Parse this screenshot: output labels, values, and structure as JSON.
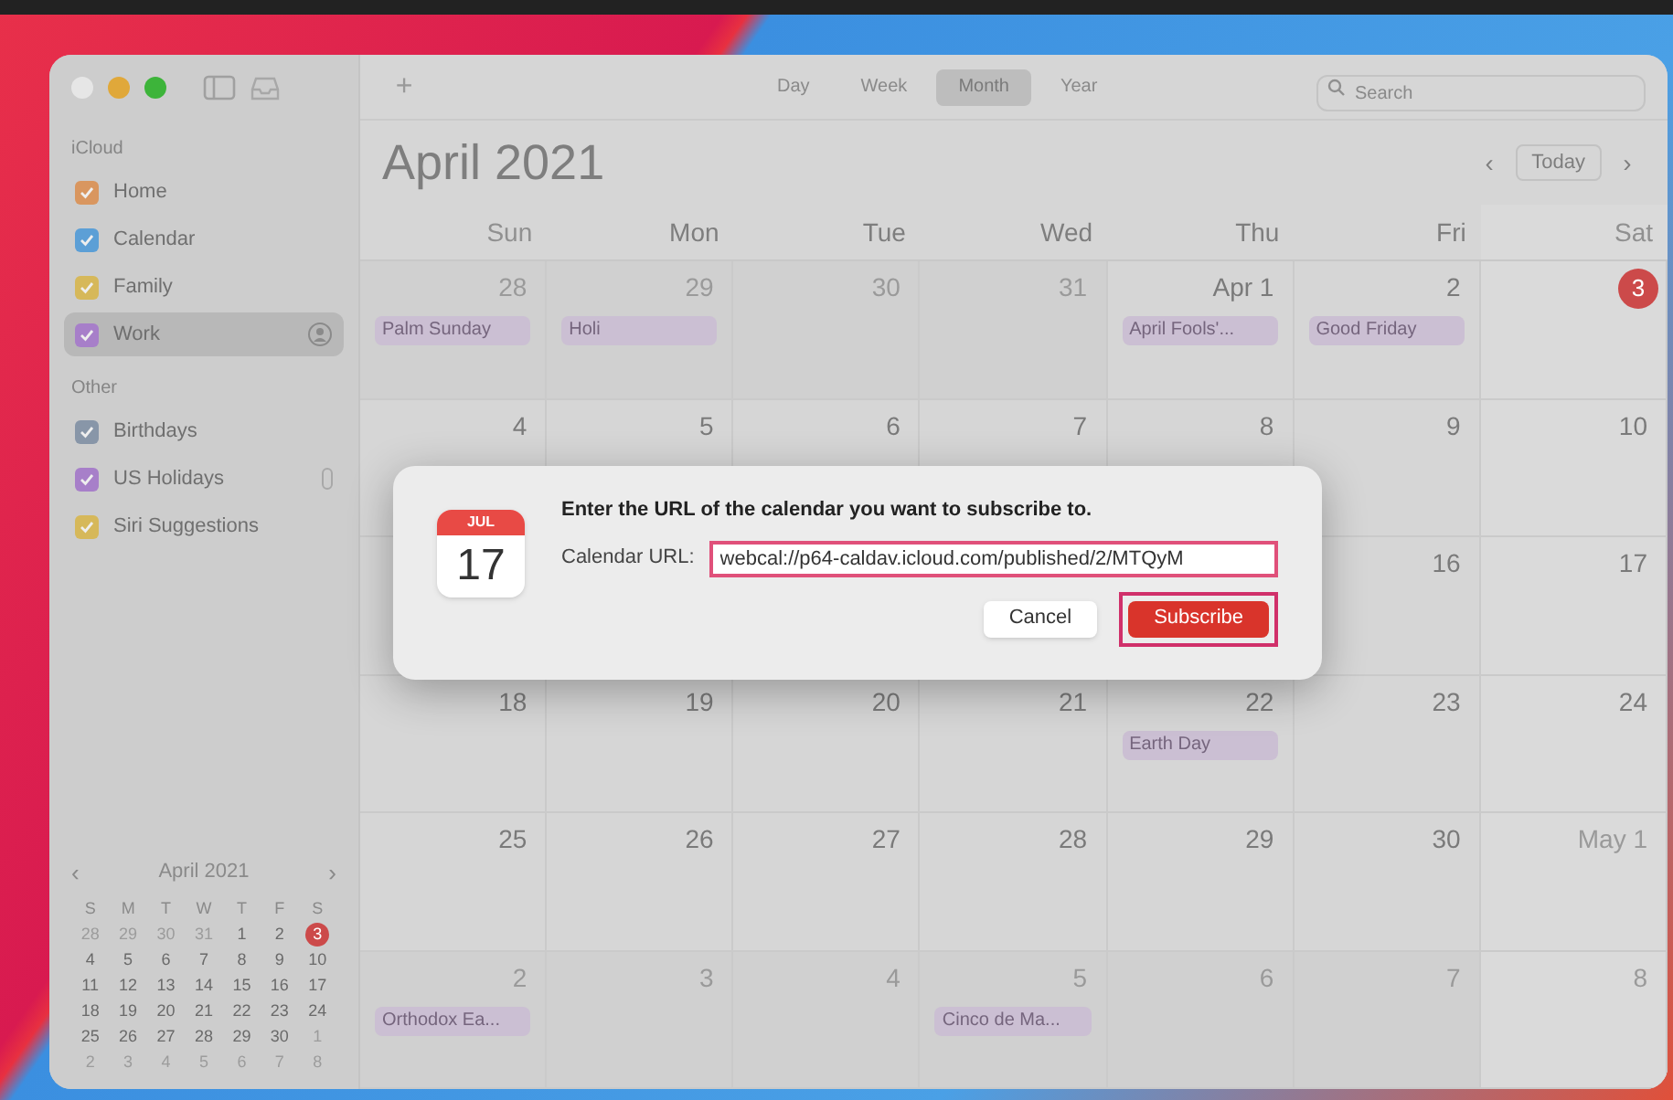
{
  "toolbar": {
    "add": "+",
    "views": [
      {
        "label": "Day",
        "selected": false
      },
      {
        "label": "Week",
        "selected": false
      },
      {
        "label": "Month",
        "selected": true
      },
      {
        "label": "Year",
        "selected": false
      }
    ],
    "search": {
      "placeholder": "Search"
    }
  },
  "sidebar": {
    "groups": [
      {
        "title": "iCloud",
        "items": [
          {
            "label": "Home",
            "color": "#d9965f",
            "selected": false,
            "shared": false,
            "subscribed": false
          },
          {
            "label": "Calendar",
            "color": "#5c9fd6",
            "selected": false,
            "shared": false,
            "subscribed": false
          },
          {
            "label": "Family",
            "color": "#d6b85a",
            "selected": false,
            "shared": false,
            "subscribed": false
          },
          {
            "label": "Work",
            "color": "#a77fc9",
            "selected": true,
            "shared": true,
            "subscribed": false
          }
        ]
      },
      {
        "title": "Other",
        "items": [
          {
            "label": "Birthdays",
            "color": "#8896a8",
            "selected": false,
            "shared": false,
            "subscribed": false
          },
          {
            "label": "US Holidays",
            "color": "#a77fc9",
            "selected": false,
            "shared": false,
            "subscribed": true
          },
          {
            "label": "Siri Suggestions",
            "color": "#d6b85a",
            "selected": false,
            "shared": false,
            "subscribed": false
          }
        ]
      }
    ],
    "mini_calendar": {
      "title": "April 2021",
      "prev": "‹",
      "next": "›",
      "weekdays": [
        "S",
        "M",
        "T",
        "W",
        "T",
        "F",
        "S"
      ],
      "weeks": [
        [
          {
            "label": "28",
            "in_month": false,
            "today": false
          },
          {
            "label": "29",
            "in_month": false,
            "today": false
          },
          {
            "label": "30",
            "in_month": false,
            "today": false
          },
          {
            "label": "31",
            "in_month": false,
            "today": false
          },
          {
            "label": "1",
            "in_month": true,
            "today": false
          },
          {
            "label": "2",
            "in_month": true,
            "today": false
          },
          {
            "label": "3",
            "in_month": true,
            "today": true
          }
        ],
        [
          {
            "label": "4",
            "in_month": true,
            "today": false
          },
          {
            "label": "5",
            "in_month": true,
            "today": false
          },
          {
            "label": "6",
            "in_month": true,
            "today": false
          },
          {
            "label": "7",
            "in_month": true,
            "today": false
          },
          {
            "label": "8",
            "in_month": true,
            "today": false
          },
          {
            "label": "9",
            "in_month": true,
            "today": false
          },
          {
            "label": "10",
            "in_month": true,
            "today": false
          }
        ],
        [
          {
            "label": "11",
            "in_month": true,
            "today": false
          },
          {
            "label": "12",
            "in_month": true,
            "today": false
          },
          {
            "label": "13",
            "in_month": true,
            "today": false
          },
          {
            "label": "14",
            "in_month": true,
            "today": false
          },
          {
            "label": "15",
            "in_month": true,
            "today": false
          },
          {
            "label": "16",
            "in_month": true,
            "today": false
          },
          {
            "label": "17",
            "in_month": true,
            "today": false
          }
        ],
        [
          {
            "label": "18",
            "in_month": true,
            "today": false
          },
          {
            "label": "19",
            "in_month": true,
            "today": false
          },
          {
            "label": "20",
            "in_month": true,
            "today": false
          },
          {
            "label": "21",
            "in_month": true,
            "today": false
          },
          {
            "label": "22",
            "in_month": true,
            "today": false
          },
          {
            "label": "23",
            "in_month": true,
            "today": false
          },
          {
            "label": "24",
            "in_month": true,
            "today": false
          }
        ],
        [
          {
            "label": "25",
            "in_month": true,
            "today": false
          },
          {
            "label": "26",
            "in_month": true,
            "today": false
          },
          {
            "label": "27",
            "in_month": true,
            "today": false
          },
          {
            "label": "28",
            "in_month": true,
            "today": false
          },
          {
            "label": "29",
            "in_month": true,
            "today": false
          },
          {
            "label": "30",
            "in_month": true,
            "today": false
          },
          {
            "label": "1",
            "in_month": false,
            "today": false
          }
        ],
        [
          {
            "label": "2",
            "in_month": false,
            "today": false
          },
          {
            "label": "3",
            "in_month": false,
            "today": false
          },
          {
            "label": "4",
            "in_month": false,
            "today": false
          },
          {
            "label": "5",
            "in_month": false,
            "today": false
          },
          {
            "label": "6",
            "in_month": false,
            "today": false
          },
          {
            "label": "7",
            "in_month": false,
            "today": false
          },
          {
            "label": "8",
            "in_month": false,
            "today": false
          }
        ]
      ]
    }
  },
  "header": {
    "title": "**April** 2021",
    "prev": "‹",
    "today": "Today",
    "next": "›"
  },
  "weekdays": [
    "Sun",
    "Mon",
    "Tue",
    "Wed",
    "Thu",
    "Fri",
    "Sat"
  ],
  "weeks": [
    [
      {
        "label": "28",
        "in_month": false,
        "today": false,
        "events": [
          "Palm Sunday"
        ]
      },
      {
        "label": "29",
        "in_month": false,
        "today": false,
        "events": [
          "Holi"
        ]
      },
      {
        "label": "30",
        "in_month": false,
        "today": false
      },
      {
        "label": "31",
        "in_month": false,
        "today": false
      },
      {
        "label": "Apr 1",
        "in_month": true,
        "today": false,
        "events": [
          "April Fools'..."
        ]
      },
      {
        "label": "2",
        "in_month": true,
        "today": false,
        "events": [
          "Good Friday"
        ]
      },
      {
        "label": "3",
        "in_month": true,
        "today": true
      }
    ],
    [
      {
        "label": "4",
        "in_month": true,
        "today": false
      },
      {
        "label": "5",
        "in_month": true,
        "today": false
      },
      {
        "label": "6",
        "in_month": true,
        "today": false
      },
      {
        "label": "7",
        "in_month": true,
        "today": false
      },
      {
        "label": "8",
        "in_month": true,
        "today": false
      },
      {
        "label": "9",
        "in_month": true,
        "today": false
      },
      {
        "label": "10",
        "in_month": true,
        "today": false
      }
    ],
    [
      {
        "label": "16",
        "in_month": true,
        "today": false
      },
      {
        "label": "17",
        "in_month": true,
        "today": false
      }
    ],
    [
      {
        "label": "18",
        "in_month": true,
        "today": false
      },
      {
        "label": "19",
        "in_month": true,
        "today": false
      },
      {
        "label": "20",
        "in_month": true,
        "today": false
      },
      {
        "label": "21",
        "in_month": true,
        "today": false
      },
      {
        "label": "22",
        "in_month": true,
        "today": false,
        "events": [
          "Earth Day"
        ]
      },
      {
        "label": "23",
        "in_month": true,
        "today": false
      },
      {
        "label": "24",
        "in_month": true,
        "today": false
      }
    ],
    [
      {
        "label": "25",
        "in_month": true,
        "today": false
      },
      {
        "label": "26",
        "in_month": true,
        "today": false
      },
      {
        "label": "27",
        "in_month": true,
        "today": false
      },
      {
        "label": "28",
        "in_month": true,
        "today": false
      },
      {
        "label": "29",
        "in_month": true,
        "today": false
      },
      {
        "label": "30",
        "in_month": true,
        "today": false
      },
      {
        "label": "May 1",
        "in_month": false,
        "today": false
      }
    ],
    [
      {
        "label": "2",
        "in_month": false,
        "today": false,
        "events": [
          "Orthodox Ea..."
        ]
      },
      {
        "label": "3",
        "in_month": false,
        "today": false
      },
      {
        "label": "4",
        "in_month": false,
        "today": false
      },
      {
        "label": "5",
        "in_month": false,
        "today": false,
        "events": [
          "Cinco de Ma..."
        ]
      },
      {
        "label": "6",
        "in_month": false,
        "today": false
      },
      {
        "label": "7",
        "in_month": false,
        "today": false
      },
      {
        "label": "8",
        "in_month": false,
        "today": false
      }
    ]
  ],
  "dialog": {
    "icon_month": "JUL",
    "icon_day": "17",
    "message": "Enter the URL of the calendar you want to subscribe to.",
    "field_label": "Calendar URL:",
    "url": "webcal://p64-caldav.icloud.com/published/2/MTQyM",
    "url_highlighted": true,
    "buttons": [
      {
        "label": "Cancel",
        "kind": "secondary",
        "highlighted": false
      },
      {
        "label": "Subscribe",
        "kind": "primary",
        "highlighted": true
      }
    ]
  }
}
